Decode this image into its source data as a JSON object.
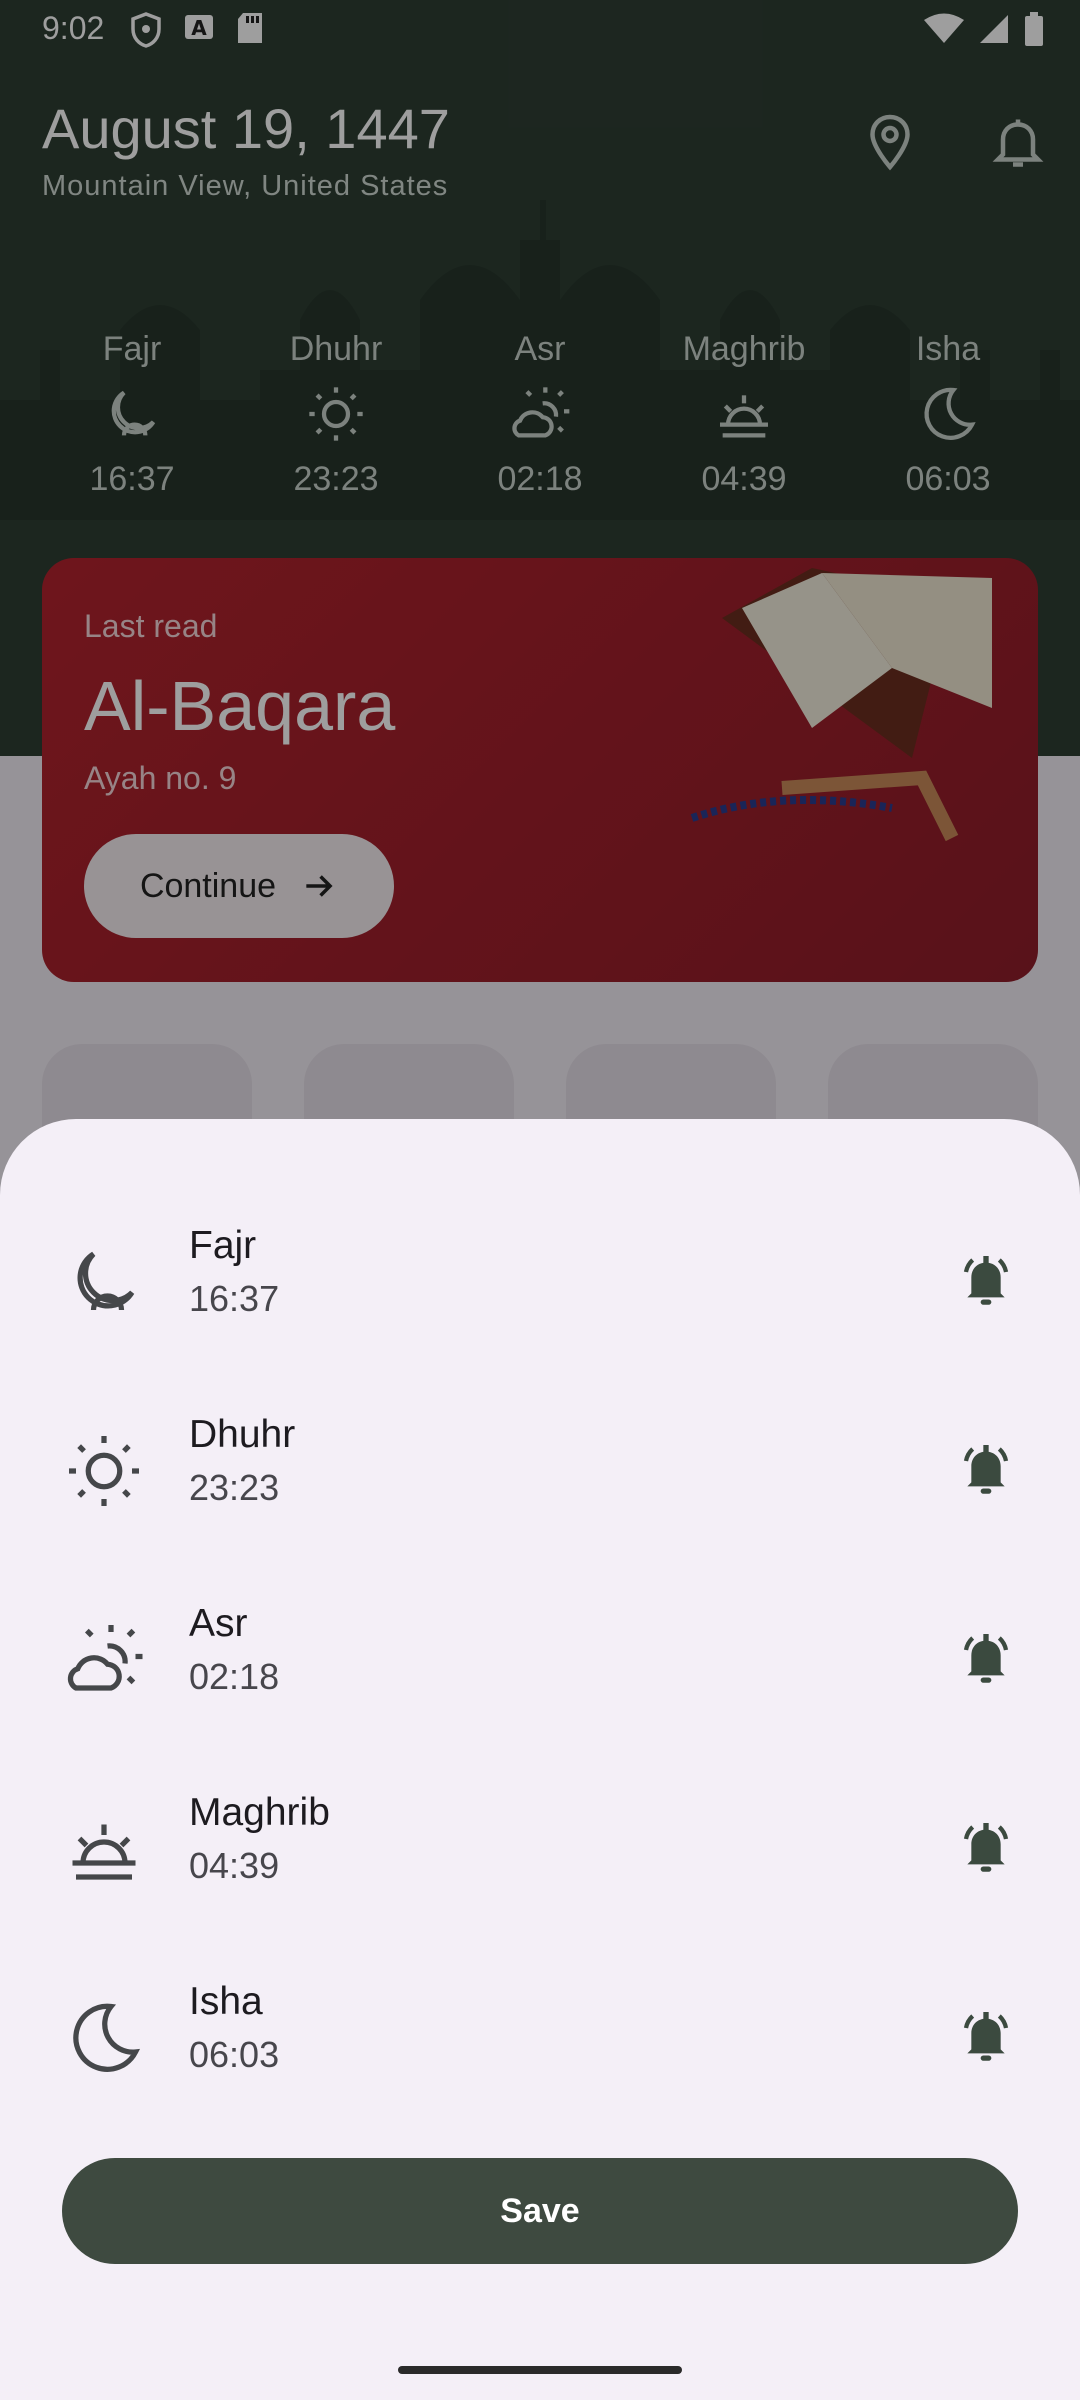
{
  "status": {
    "time": "9:02"
  },
  "header": {
    "date": "August 19, 1447",
    "location": "Mountain View, United States"
  },
  "prayer_strip": [
    {
      "name": "Fajr",
      "time": "16:37",
      "icon": "moon-sun-icon"
    },
    {
      "name": "Dhuhr",
      "time": "23:23",
      "icon": "sun-icon"
    },
    {
      "name": "Asr",
      "time": "02:18",
      "icon": "sun-cloud-icon"
    },
    {
      "name": "Maghrib",
      "time": "04:39",
      "icon": "sunset-icon"
    },
    {
      "name": "Isha",
      "time": "06:03",
      "icon": "crescent-moon-icon"
    }
  ],
  "last_read": {
    "label": "Last read",
    "surah": "Al-Baqara",
    "ayah": "Ayah no. 9",
    "button": "Continue"
  },
  "sheet": {
    "prayers": [
      {
        "name": "Fajr",
        "time": "16:37",
        "icon": "moon-sun-icon",
        "alarm": "bell-ringing-icon"
      },
      {
        "name": "Dhuhr",
        "time": "23:23",
        "icon": "sun-icon",
        "alarm": "bell-ringing-icon"
      },
      {
        "name": "Asr",
        "time": "02:18",
        "icon": "sun-cloud-icon",
        "alarm": "bell-ringing-icon"
      },
      {
        "name": "Maghrib",
        "time": "04:39",
        "icon": "sunset-icon",
        "alarm": "bell-ringing-icon"
      },
      {
        "name": "Isha",
        "time": "06:03",
        "icon": "crescent-moon-icon",
        "alarm": "bell-ringing-icon"
      }
    ],
    "save_label": "Save"
  },
  "colors": {
    "primary_dark_green": "#3e4a40",
    "header_green": "#2e3e33",
    "card_red": "#b3232e",
    "sheet_bg": "#f4eff7",
    "bell_color": "#3b4a3f"
  }
}
